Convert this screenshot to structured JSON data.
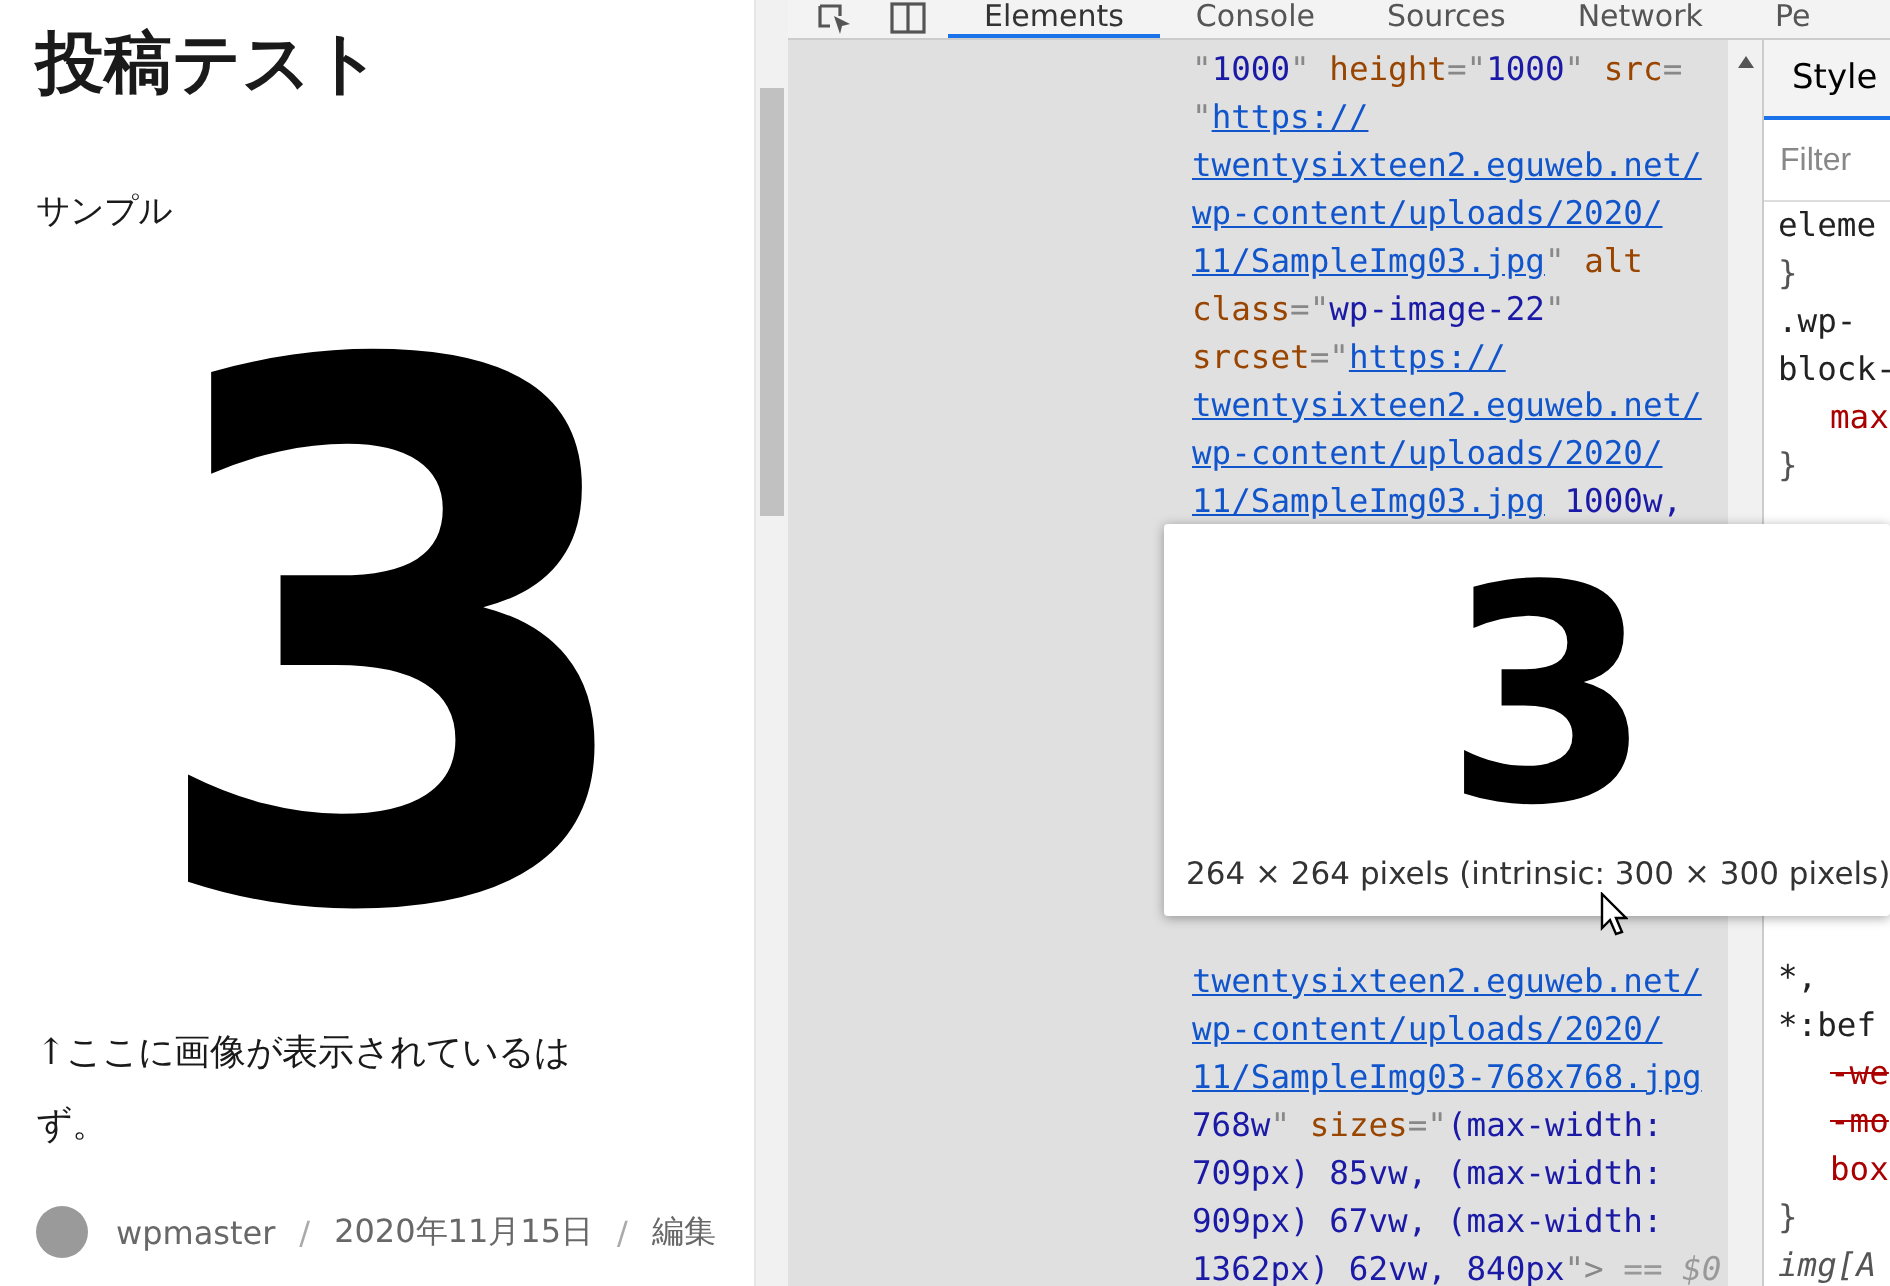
{
  "post": {
    "title": "投稿テスト",
    "excerpt": "サンプル",
    "image_text": "3",
    "caption": "↑ここに画像が表示されているはず。",
    "meta": [
      {
        "kind": "author",
        "text": "wpmaster"
      },
      {
        "kind": "separator",
        "text": "/"
      },
      {
        "kind": "date",
        "text": "2020年11月15日"
      },
      {
        "kind": "separator",
        "text": "/"
      },
      {
        "kind": "link",
        "text": "編集"
      }
    ]
  },
  "devtools": {
    "tabs": [
      {
        "label": "Elements",
        "selected": true
      },
      {
        "label": "Console",
        "selected": false
      },
      {
        "label": "Sources",
        "selected": false
      },
      {
        "label": "Network",
        "selected": false
      },
      {
        "label": "Pe",
        "selected": false
      }
    ],
    "code_top": [
      [
        {
          "kind": "punct",
          "text": "\""
        },
        {
          "kind": "value",
          "text": "1000"
        },
        {
          "kind": "punct",
          "text": "\""
        },
        {
          "kind": "attr",
          "text": " height"
        },
        {
          "kind": "punct",
          "text": "=\""
        },
        {
          "kind": "value",
          "text": "1000"
        },
        {
          "kind": "punct",
          "text": "\""
        },
        {
          "kind": "attr",
          "text": " src"
        },
        {
          "kind": "punct",
          "text": "="
        }
      ],
      [
        {
          "kind": "punct",
          "text": "\""
        },
        {
          "kind": "link",
          "text": "https://"
        }
      ],
      [
        {
          "kind": "link",
          "text": "twentysixteen2.eguweb.net/"
        }
      ],
      [
        {
          "kind": "link",
          "text": "wp-content/uploads/2020/"
        }
      ],
      [
        {
          "kind": "link",
          "text": "11/SampleImg03.jpg"
        },
        {
          "kind": "punct",
          "text": "\""
        },
        {
          "kind": "attr",
          "text": " alt"
        }
      ],
      [
        {
          "kind": "attr",
          "text": "class"
        },
        {
          "kind": "punct",
          "text": "=\""
        },
        {
          "kind": "value",
          "text": "wp-image-22"
        },
        {
          "kind": "punct",
          "text": "\""
        }
      ],
      [
        {
          "kind": "attr",
          "text": "srcset"
        },
        {
          "kind": "punct",
          "text": "=\""
        },
        {
          "kind": "link",
          "text": "https://"
        }
      ],
      [
        {
          "kind": "link",
          "text": "twentysixteen2.eguweb.net/"
        }
      ],
      [
        {
          "kind": "link",
          "text": "wp-content/uploads/2020/"
        }
      ],
      [
        {
          "kind": "link",
          "text": "11/SampleImg03.jpg"
        },
        {
          "kind": "value",
          "text": " 1000w,"
        }
      ]
    ],
    "code_bottom": [
      [
        {
          "kind": "link",
          "text": "twentysixteen2.eguweb.net/"
        }
      ],
      [
        {
          "kind": "link",
          "text": "wp-content/uploads/2020/"
        }
      ],
      [
        {
          "kind": "link",
          "text": "11/SampleImg03-768x768.jpg"
        }
      ],
      [
        {
          "kind": "value",
          "text": "768w"
        },
        {
          "kind": "punct",
          "text": "\""
        },
        {
          "kind": "attr",
          "text": " sizes"
        },
        {
          "kind": "punct",
          "text": "=\""
        },
        {
          "kind": "value",
          "text": "(max-width:"
        }
      ],
      [
        {
          "kind": "value",
          "text": "709px) 85vw, (max-width:"
        }
      ],
      [
        {
          "kind": "value",
          "text": "909px) 67vw, (max-width:"
        }
      ],
      [
        {
          "kind": "value",
          "text": "1362px) 62vw, 840px"
        },
        {
          "kind": "punct",
          "text": "\">"
        },
        {
          "kind": "note",
          "text": " == $0"
        }
      ]
    ],
    "tooltip": {
      "preview_text": "3",
      "size": "264 × 264 pixels (intrinsic: 300 × 300 pixels)"
    },
    "styles": {
      "tab": "Style",
      "filter_placeholder": "Filter",
      "rules_top": [
        {
          "kind": "selector",
          "text": "eleme"
        },
        {
          "kind": "brace",
          "text": "}"
        },
        {
          "kind": "selector",
          "text": ".wp-"
        },
        {
          "kind": "selector",
          "text": "block-"
        },
        {
          "kind": "prop",
          "text": "max"
        },
        {
          "kind": "brace",
          "text": "}"
        }
      ],
      "rules_bottom": [
        {
          "kind": "selector",
          "text": "*,"
        },
        {
          "kind": "selector",
          "text": "*:bef"
        },
        {
          "kind": "struck",
          "text": "-we"
        },
        {
          "kind": "struck",
          "text": "-mo"
        },
        {
          "kind": "prop",
          "text": "box"
        },
        {
          "kind": "brace",
          "text": "}"
        },
        {
          "kind": "italic",
          "text": "img[A"
        }
      ]
    }
  }
}
